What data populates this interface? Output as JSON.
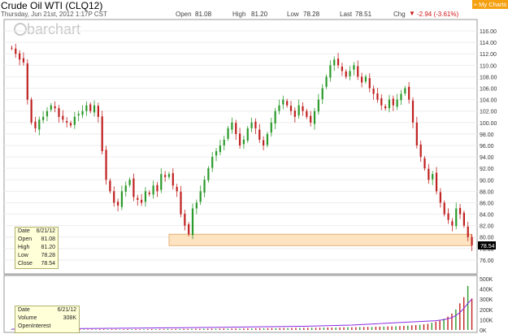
{
  "header": {
    "title": "Crude Oil WTI (CLQ12)",
    "date": "Thursday, Jun 21st, 2012 1:17P CST",
    "open_label": "Open",
    "open": "81.08",
    "high_label": "High",
    "high": "81.20",
    "low_label": "Low",
    "low": "78.28",
    "last_label": "Last",
    "last": "78.51",
    "chg_label": "Chg",
    "chg": "-2.94 (-3.61%)",
    "my_charts": "+ My Charts"
  },
  "watermark": "barchart",
  "info_box": {
    "date_label": "Date",
    "date": "6/21/12",
    "open_label": "Open",
    "open": "81.08",
    "high_label": "High",
    "high": "81.20",
    "low_label": "Low",
    "low": "78.28",
    "close_label": "Close",
    "close": "78.54"
  },
  "volume_box": {
    "date_label": "Date",
    "date": "6/21/12",
    "volume_label": "Volume",
    "volume": "308K",
    "oi_label": "OpenInterest"
  },
  "last_price_tag": "78.54",
  "colors": {
    "up": "#2a9a2a",
    "down": "#c02020",
    "oi_line": "#8a2be2",
    "highlight": "#fde3c0"
  },
  "chart_data": [
    {
      "type": "candlestick",
      "title": "Crude Oil WTI (CLQ12)",
      "ylim": [
        74,
        117
      ],
      "yticks": [
        "116.00",
        "114.00",
        "112.00",
        "110.00",
        "108.00",
        "106.00",
        "104.00",
        "102.00",
        "100.00",
        "98.00",
        "96.00",
        "94.00",
        "92.00",
        "90.00",
        "88.00",
        "86.00",
        "84.00",
        "82.00",
        "80.00",
        "78.00",
        "76.00"
      ],
      "closes": [
        113,
        112,
        111,
        110.5,
        104,
        100,
        99,
        100.5,
        101,
        102,
        103,
        102.5,
        101,
        100.5,
        100,
        99.5,
        101,
        101.5,
        102,
        103,
        102,
        103,
        101,
        95,
        90,
        88,
        86,
        85.5,
        88,
        89,
        90,
        87,
        86.5,
        86,
        88,
        87.5,
        89,
        88,
        91,
        90.5,
        91,
        89,
        88,
        84,
        82,
        80.5,
        85,
        86,
        88,
        90,
        92,
        94,
        95,
        96,
        97,
        99,
        100,
        98,
        96,
        97,
        99,
        100,
        99,
        97,
        96,
        98,
        100,
        102,
        103,
        104,
        103,
        102,
        101,
        103,
        102,
        101,
        100,
        102,
        104,
        106,
        108,
        110,
        111,
        110,
        109,
        108,
        109,
        110,
        108,
        107,
        108,
        106,
        105,
        104,
        103,
        102.5,
        104,
        103,
        104,
        105,
        106,
        104,
        100,
        96,
        94,
        92,
        90,
        91,
        88,
        86,
        84,
        83,
        82,
        85,
        84,
        82,
        80,
        78.54
      ],
      "zone": [
        78.5,
        80.5
      ]
    },
    {
      "type": "bar",
      "title": "",
      "ylim": [
        0,
        500000
      ],
      "yticks": [
        "500K",
        "400K",
        "300K",
        "200K",
        "100K",
        "0K"
      ],
      "volumes": [
        5,
        5,
        5,
        5,
        6,
        5,
        5,
        6,
        5,
        5,
        6,
        5,
        5,
        5,
        6,
        6,
        5,
        6,
        6,
        5,
        6,
        6,
        7,
        7,
        6,
        7,
        7,
        6,
        7,
        8,
        7,
        8,
        7,
        8,
        8,
        9,
        8,
        9,
        9,
        10,
        9,
        10,
        10,
        11,
        10,
        11,
        12,
        11,
        12,
        12,
        13,
        12,
        13,
        14,
        13,
        14,
        15,
        14,
        15,
        16,
        15,
        16,
        17,
        16,
        17,
        18,
        17,
        18,
        19,
        18,
        19,
        20,
        19,
        20,
        21,
        22,
        21,
        22,
        23,
        24,
        23,
        24,
        25,
        26,
        27,
        26,
        27,
        28,
        29,
        30,
        29,
        31,
        32,
        33,
        34,
        35,
        36,
        38,
        40,
        42,
        45,
        48,
        50,
        55,
        60,
        70,
        80,
        90,
        110,
        130,
        160,
        200,
        260,
        320,
        430,
        308
      ],
      "open_interest": [
        8,
        8,
        8,
        9,
        9,
        9,
        10,
        10,
        10,
        11,
        11,
        11,
        12,
        12,
        12,
        13,
        13,
        13,
        14,
        14,
        14,
        15,
        15,
        15,
        16,
        16,
        16,
        17,
        17,
        17,
        18,
        18,
        18,
        19,
        19,
        19,
        20,
        20,
        20,
        21,
        21,
        21,
        22,
        22,
        22,
        23,
        23,
        24,
        24,
        24,
        25,
        25,
        26,
        26,
        27,
        27,
        28,
        28,
        29,
        29,
        30,
        30,
        31,
        31,
        32,
        32,
        33,
        33,
        34,
        34,
        35,
        35,
        36,
        36,
        37,
        38,
        39,
        40,
        41,
        42,
        43,
        44,
        45,
        46,
        47,
        48,
        50,
        52,
        54,
        56,
        58,
        60,
        62,
        64,
        66,
        68,
        70,
        72,
        74,
        76,
        78,
        80,
        82,
        84,
        86,
        88,
        90,
        95,
        100,
        110,
        120,
        140,
        170,
        210,
        260,
        300
      ]
    }
  ]
}
